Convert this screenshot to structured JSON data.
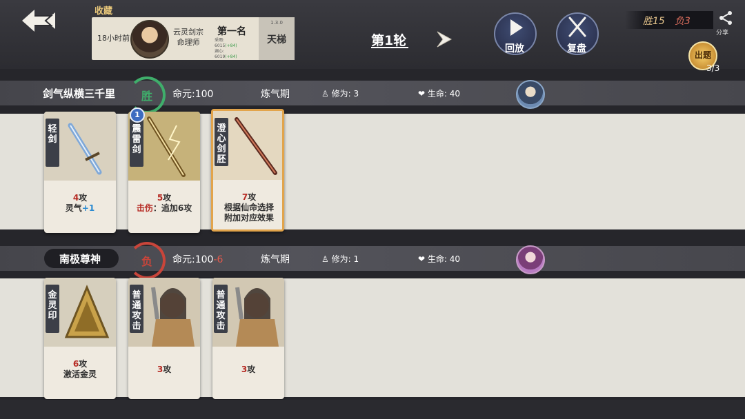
{
  "header": {
    "favorite_tag": "收藏",
    "record": {
      "time": "18小时前",
      "sect_line1": "云灵剑宗",
      "sect_line2": "命理师",
      "rank": "第一名",
      "sub_line1": "采雨:",
      "sub_val1": "6015",
      "sub_delta1": "(+84)",
      "sub_line2": "澜心:",
      "sub_val2": "6019",
      "sub_delta2": "(+84)",
      "version": "1.3.0",
      "ladder_label": "天梯"
    },
    "round_title": "第1轮",
    "replay_label": "回放",
    "review_label": "复盘",
    "score": {
      "win": "胜15",
      "lose": "负3"
    },
    "share_label": "分享",
    "puzzle": {
      "label": "出题",
      "count": "3/3"
    }
  },
  "players": [
    {
      "name": "剑气纵横三千里",
      "result": "胜",
      "destiny_label": "命元:",
      "destiny_value": "100",
      "destiny_delta": "",
      "realm": "炼气期",
      "cultivation_label": "修为:",
      "cultivation_value": "3",
      "life_label": "生命:",
      "life_value": "40",
      "cards": [
        {
          "name": "轻剑",
          "attack": "4",
          "atk_suffix": "攻",
          "line2_prefix": "灵气",
          "line2_value": "+1",
          "line3": ""
        },
        {
          "name": "震雷剑",
          "attack": "5",
          "atk_suffix": "攻",
          "line2_prefix": "击伤",
          "line2_value": "：追加6攻",
          "line3": "",
          "level": "1"
        },
        {
          "name": "澄心剑胚",
          "attack": "7",
          "atk_suffix": "攻",
          "line2_prefix": "根据仙命选择",
          "line2_value": "",
          "line3": "附加对应效果"
        }
      ]
    },
    {
      "name": "南极尊神",
      "result": "负",
      "destiny_label": "命元:",
      "destiny_value": "100",
      "destiny_delta": "-6",
      "realm": "炼气期",
      "cultivation_label": "修为:",
      "cultivation_value": "1",
      "life_label": "生命:",
      "life_value": "40",
      "cards": [
        {
          "name": "金灵印",
          "attack": "6",
          "atk_suffix": "攻",
          "line2_prefix": "激活金灵",
          "line2_value": "",
          "line3": ""
        },
        {
          "name": "普通攻击",
          "attack": "3",
          "atk_suffix": "攻",
          "line2_prefix": "",
          "line2_value": "",
          "line3": ""
        },
        {
          "name": "普通攻击",
          "attack": "3",
          "atk_suffix": "攻",
          "line2_prefix": "",
          "line2_value": "",
          "line3": ""
        }
      ]
    }
  ],
  "colors": {
    "win": "#3fae6b",
    "lose": "#c9453a",
    "attack_red": "#b62b24",
    "accent_gold": "#e6c58d"
  },
  "icons": {
    "back": "back-arrow-icon",
    "next": "chevron-right-icon",
    "replay": "play-icon",
    "review": "crossed-swords-icon",
    "share": "share-icon",
    "cultivation": "meditation-icon",
    "life": "heart-icon"
  }
}
